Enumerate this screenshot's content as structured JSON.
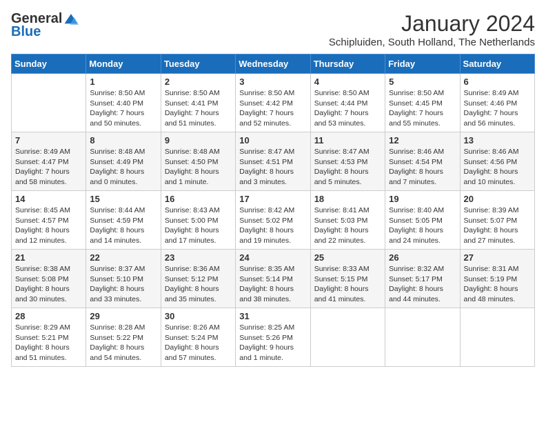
{
  "logo": {
    "line1": "General",
    "line2": "Blue"
  },
  "title": "January 2024",
  "location": "Schipluiden, South Holland, The Netherlands",
  "days_of_week": [
    "Sunday",
    "Monday",
    "Tuesday",
    "Wednesday",
    "Thursday",
    "Friday",
    "Saturday"
  ],
  "weeks": [
    [
      {
        "day": "",
        "info": ""
      },
      {
        "day": "1",
        "info": "Sunrise: 8:50 AM\nSunset: 4:40 PM\nDaylight: 7 hours\nand 50 minutes."
      },
      {
        "day": "2",
        "info": "Sunrise: 8:50 AM\nSunset: 4:41 PM\nDaylight: 7 hours\nand 51 minutes."
      },
      {
        "day": "3",
        "info": "Sunrise: 8:50 AM\nSunset: 4:42 PM\nDaylight: 7 hours\nand 52 minutes."
      },
      {
        "day": "4",
        "info": "Sunrise: 8:50 AM\nSunset: 4:44 PM\nDaylight: 7 hours\nand 53 minutes."
      },
      {
        "day": "5",
        "info": "Sunrise: 8:50 AM\nSunset: 4:45 PM\nDaylight: 7 hours\nand 55 minutes."
      },
      {
        "day": "6",
        "info": "Sunrise: 8:49 AM\nSunset: 4:46 PM\nDaylight: 7 hours\nand 56 minutes."
      }
    ],
    [
      {
        "day": "7",
        "info": "Sunrise: 8:49 AM\nSunset: 4:47 PM\nDaylight: 7 hours\nand 58 minutes."
      },
      {
        "day": "8",
        "info": "Sunrise: 8:48 AM\nSunset: 4:49 PM\nDaylight: 8 hours\nand 0 minutes."
      },
      {
        "day": "9",
        "info": "Sunrise: 8:48 AM\nSunset: 4:50 PM\nDaylight: 8 hours\nand 1 minute."
      },
      {
        "day": "10",
        "info": "Sunrise: 8:47 AM\nSunset: 4:51 PM\nDaylight: 8 hours\nand 3 minutes."
      },
      {
        "day": "11",
        "info": "Sunrise: 8:47 AM\nSunset: 4:53 PM\nDaylight: 8 hours\nand 5 minutes."
      },
      {
        "day": "12",
        "info": "Sunrise: 8:46 AM\nSunset: 4:54 PM\nDaylight: 8 hours\nand 7 minutes."
      },
      {
        "day": "13",
        "info": "Sunrise: 8:46 AM\nSunset: 4:56 PM\nDaylight: 8 hours\nand 10 minutes."
      }
    ],
    [
      {
        "day": "14",
        "info": "Sunrise: 8:45 AM\nSunset: 4:57 PM\nDaylight: 8 hours\nand 12 minutes."
      },
      {
        "day": "15",
        "info": "Sunrise: 8:44 AM\nSunset: 4:59 PM\nDaylight: 8 hours\nand 14 minutes."
      },
      {
        "day": "16",
        "info": "Sunrise: 8:43 AM\nSunset: 5:00 PM\nDaylight: 8 hours\nand 17 minutes."
      },
      {
        "day": "17",
        "info": "Sunrise: 8:42 AM\nSunset: 5:02 PM\nDaylight: 8 hours\nand 19 minutes."
      },
      {
        "day": "18",
        "info": "Sunrise: 8:41 AM\nSunset: 5:03 PM\nDaylight: 8 hours\nand 22 minutes."
      },
      {
        "day": "19",
        "info": "Sunrise: 8:40 AM\nSunset: 5:05 PM\nDaylight: 8 hours\nand 24 minutes."
      },
      {
        "day": "20",
        "info": "Sunrise: 8:39 AM\nSunset: 5:07 PM\nDaylight: 8 hours\nand 27 minutes."
      }
    ],
    [
      {
        "day": "21",
        "info": "Sunrise: 8:38 AM\nSunset: 5:08 PM\nDaylight: 8 hours\nand 30 minutes."
      },
      {
        "day": "22",
        "info": "Sunrise: 8:37 AM\nSunset: 5:10 PM\nDaylight: 8 hours\nand 33 minutes."
      },
      {
        "day": "23",
        "info": "Sunrise: 8:36 AM\nSunset: 5:12 PM\nDaylight: 8 hours\nand 35 minutes."
      },
      {
        "day": "24",
        "info": "Sunrise: 8:35 AM\nSunset: 5:14 PM\nDaylight: 8 hours\nand 38 minutes."
      },
      {
        "day": "25",
        "info": "Sunrise: 8:33 AM\nSunset: 5:15 PM\nDaylight: 8 hours\nand 41 minutes."
      },
      {
        "day": "26",
        "info": "Sunrise: 8:32 AM\nSunset: 5:17 PM\nDaylight: 8 hours\nand 44 minutes."
      },
      {
        "day": "27",
        "info": "Sunrise: 8:31 AM\nSunset: 5:19 PM\nDaylight: 8 hours\nand 48 minutes."
      }
    ],
    [
      {
        "day": "28",
        "info": "Sunrise: 8:29 AM\nSunset: 5:21 PM\nDaylight: 8 hours\nand 51 minutes."
      },
      {
        "day": "29",
        "info": "Sunrise: 8:28 AM\nSunset: 5:22 PM\nDaylight: 8 hours\nand 54 minutes."
      },
      {
        "day": "30",
        "info": "Sunrise: 8:26 AM\nSunset: 5:24 PM\nDaylight: 8 hours\nand 57 minutes."
      },
      {
        "day": "31",
        "info": "Sunrise: 8:25 AM\nSunset: 5:26 PM\nDaylight: 9 hours\nand 1 minute."
      },
      {
        "day": "",
        "info": ""
      },
      {
        "day": "",
        "info": ""
      },
      {
        "day": "",
        "info": ""
      }
    ]
  ]
}
